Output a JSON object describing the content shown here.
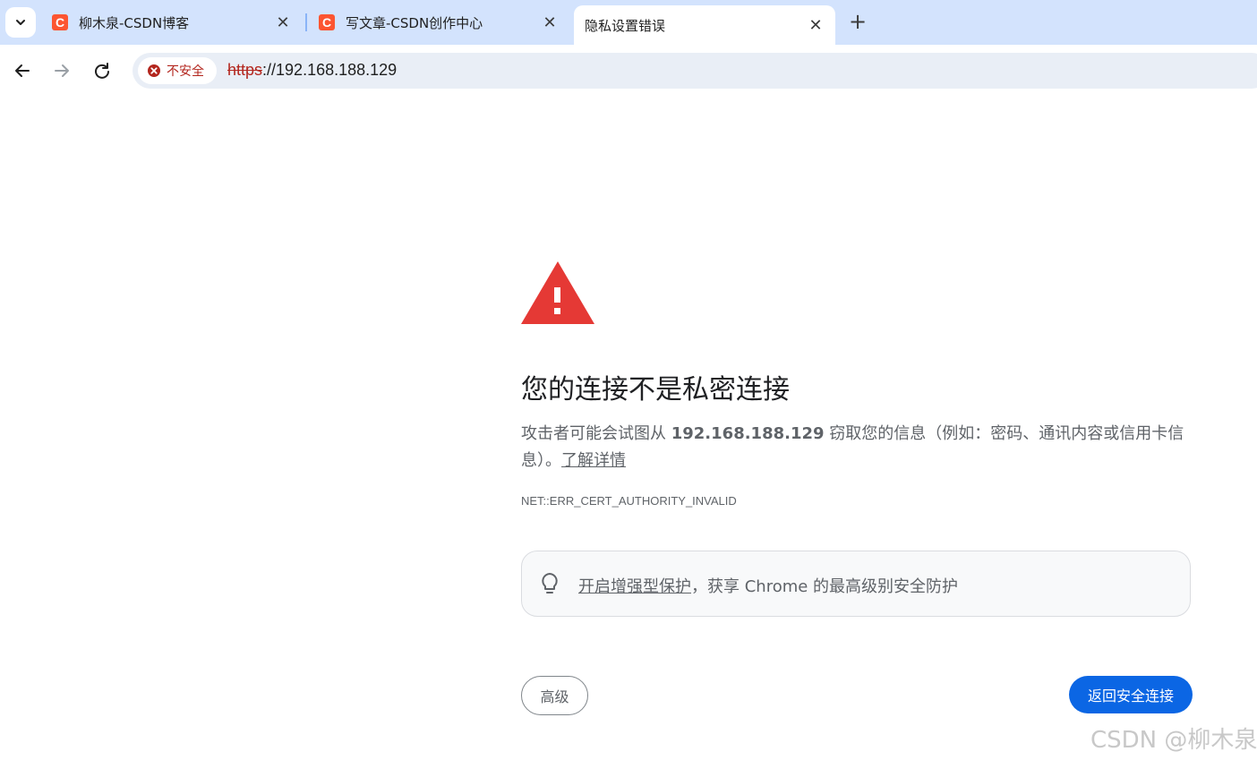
{
  "tabs": [
    {
      "title": "柳木泉-CSDN博客",
      "favicon": "csdn-icon",
      "active": false
    },
    {
      "title": "写文章-CSDN创作中心",
      "favicon": "csdn-icon",
      "active": false
    },
    {
      "title": "隐私设置错误",
      "active": true
    }
  ],
  "favicon_letter": "C",
  "close_glyph": "✕",
  "new_tab_glyph": "+",
  "omnibox": {
    "security_label": "不安全",
    "url_scheme": "https",
    "url_rest": "://192.168.188.129"
  },
  "page": {
    "heading": "您的连接不是私密连接",
    "desc_prefix": "攻击者可能会试图从 ",
    "desc_host": "192.168.188.129",
    "desc_suffix": " 窃取您的信息（例如：密码、通讯内容或信用卡信息）。",
    "learn_more": "了解详情",
    "error_code": "NET::ERR_CERT_AUTHORITY_INVALID",
    "enhanced_link": "开启增强型保护",
    "enhanced_suffix": "，获享 Chrome 的最高级别安全防护",
    "advanced_button": "高级",
    "back_button": "返回安全连接"
  },
  "watermark": "CSDN @柳木泉",
  "colors": {
    "tabstrip_bg": "#d3e3fd",
    "warning_red": "#e53935",
    "not_secure_red": "#b3261e",
    "primary_button": "#0b66e4"
  }
}
